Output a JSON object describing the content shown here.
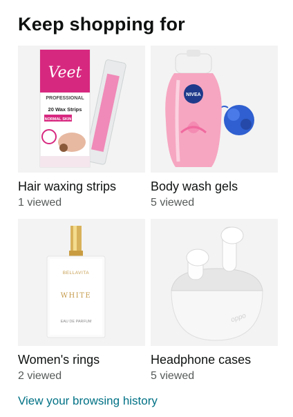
{
  "title": "Keep shopping for",
  "items": [
    {
      "name": "Hair waxing strips",
      "count": "1 viewed",
      "image": "veet-wax-strips-box",
      "brand": "Veet",
      "box_line1": "PROFESSIONAL",
      "box_line2": "20 Wax Strips",
      "box_line3": "NORMAL SKIN"
    },
    {
      "name": "Body wash gels",
      "count": "5 viewed",
      "image": "nivea-body-wash-bottle",
      "brand": "NIVEA"
    },
    {
      "name": "Women's rings",
      "count": "2 viewed",
      "image": "bellavita-perfume-bottle",
      "brand": "BELLAVITA",
      "label1": "WHITE",
      "label2": "EAU DE PARFUM"
    },
    {
      "name": "Headphone cases",
      "count": "5 viewed",
      "image": "oppo-earbuds-case",
      "brand": "oppo"
    }
  ],
  "history_link": "View your browsing history",
  "colors": {
    "link": "#007185",
    "tile_bg": "#f3f3f3",
    "veet_pink": "#d7287f",
    "nivea_blue": "#1f3a8a"
  }
}
